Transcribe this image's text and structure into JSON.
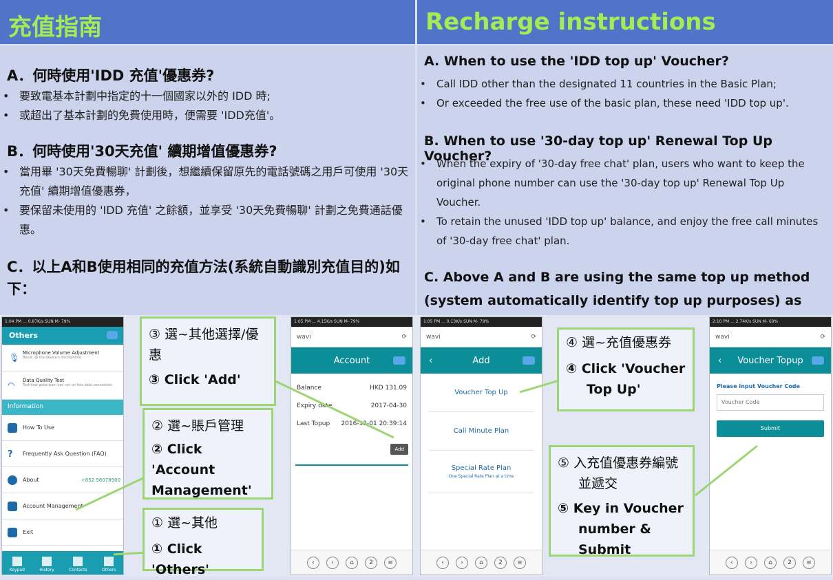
{
  "title_zh": "充值指南",
  "title_en": "Recharge instructions",
  "zh": {
    "a_title": "A．何時使用'IDD 充值'優惠券?",
    "a_bullets": [
      "要致電基本計劃中指定的十一個國家以外的 IDD 時;",
      "或超出了基本計劃的免費使用時，便需要 'IDD充值'。"
    ],
    "b_title": "B．何時使用'30天充值' 續期增值優惠券?",
    "b_bullets": [
      "當用畢 '30天免費暢聊' 計劃後，想繼續保留原先的電話號碼之用戶可使用 '30天充值' 續期增值優惠券，",
      "要保留未使用的 'IDD 充值' 之餘額，並享受 '30天免費暢聊' 計劃之免費通話優惠。"
    ],
    "c_title": "C．以上A和B使用相同的充值方法(系統自動識別充值目的)如下："
  },
  "en": {
    "a_title": "A.  When to use the 'IDD top up' Voucher?",
    "a_bullets": [
      "Call IDD other than the designated 11 countries in the Basic Plan;",
      "Or exceeded the free use of the basic plan, these need 'IDD top up'."
    ],
    "b_title": "B.  When to use '30-day top up' Renewal Top Up Voucher?",
    "b_bullets": [
      "When the expiry of '30-day free chat' plan, users who want to keep the original phone number can use the '30-day top up' Renewal Top Up Voucher.",
      "To retain the unused 'IDD top up' balance, and enjoy the free call minutes of '30-day free chat' plan."
    ],
    "c_title": "C.  Above A and B are using the same top up method (system automatically identify top up purposes) as follows:"
  },
  "phone1": {
    "status": "1:04 PM ... 0.87K/s  SUN M- 79%",
    "header": "Others",
    "items": [
      {
        "label": "Microphone Volume Adjustment",
        "sub": "Boost up the device's microphone"
      },
      {
        "label": "Data Quality Test",
        "sub": "Test how good wavi can run on this data connection"
      }
    ],
    "section": "Information",
    "info_items": [
      "How To Use",
      "Frequently Ask Question (FAQ)",
      "About",
      "Account Management",
      "Exit"
    ],
    "about_value": "+852 58078900",
    "tabs": [
      "Keypad",
      "History",
      "Contacts",
      "Others"
    ]
  },
  "phone2": {
    "status": "1:05 PM ... 4.15K/s  SUN M- 79%",
    "url": "wavi",
    "title": "Account",
    "rows": [
      {
        "k": "Balance",
        "v": "HKD 131.09"
      },
      {
        "k": "Expiry date",
        "v": "2017-04-30"
      },
      {
        "k": "Last Topup",
        "v": "2016-12-01 20:39:14"
      }
    ],
    "add_label": "Add",
    "nav": [
      "‹",
      "›",
      "⌂",
      "2",
      "≡"
    ]
  },
  "phone3": {
    "status": "1:05 PM ... 0.13K/s  SUN M- 79%",
    "url": "wavi",
    "title": "Add",
    "items": [
      "Voucher Top Up",
      "Call Minute Plan",
      "Special Rate Plan"
    ],
    "special_sub": "One Special Rate Plan at a time"
  },
  "phone4": {
    "status": "2:10 PM ... 2.74K/s  SUN M- 69%",
    "url": "wavi",
    "title": "Voucher Topup",
    "label": "Please input Voucher Code",
    "placeholder": "Voucher Code",
    "submit": "Submit"
  },
  "callouts": {
    "c3_zh": "③ 選~其他選擇/優惠",
    "c3_en": "③  Click 'Add'",
    "c2_zh": "② 選~賬戶管理",
    "c2_en": "②  Click 'Account Management'",
    "c1_zh": "① 選~其他",
    "c1_en": "①  Click 'Others'",
    "c4_zh": "④ 選~充值優惠券",
    "c4_en": "④  Click 'Voucher Top Up'",
    "c5_zh": "⑤ 入充值優惠券編號並遞交",
    "c5_en": "⑤  Key in Voucher number & Submit"
  }
}
